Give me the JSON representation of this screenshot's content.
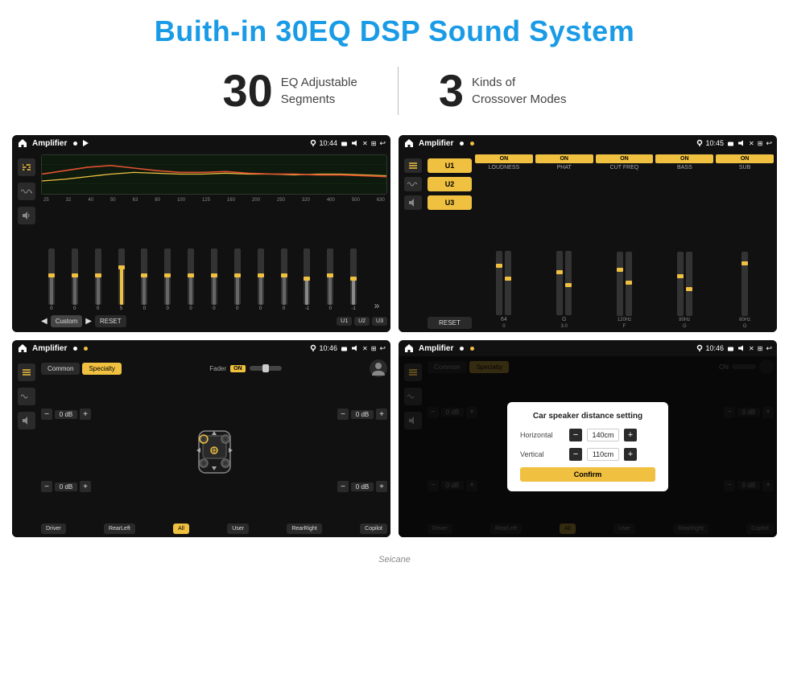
{
  "header": {
    "title": "Buith-in 30EQ DSP Sound System"
  },
  "stats": {
    "eq": {
      "number": "30",
      "desc_line1": "EQ Adjustable",
      "desc_line2": "Segments"
    },
    "crossover": {
      "number": "3",
      "desc_line1": "Kinds of",
      "desc_line2": "Crossover Modes"
    }
  },
  "screen1": {
    "title": "Amplifier",
    "time": "10:44",
    "eq_labels": [
      "25",
      "32",
      "40",
      "50",
      "63",
      "80",
      "100",
      "125",
      "160",
      "200",
      "250",
      "320",
      "400",
      "500",
      "630"
    ],
    "preset": "Custom",
    "reset_btn": "RESET",
    "u1_btn": "U1",
    "u2_btn": "U2",
    "u3_btn": "U3",
    "slider_values": [
      "0",
      "0",
      "0",
      "5",
      "0",
      "0",
      "0",
      "0",
      "0",
      "0",
      "0",
      "-1",
      "0",
      "-1"
    ]
  },
  "screen2": {
    "title": "Amplifier",
    "time": "10:45",
    "bands": [
      {
        "on": "ON",
        "name": "LOUDNESS"
      },
      {
        "on": "ON",
        "name": "PHAT"
      },
      {
        "on": "ON",
        "name": "CUT FREQ"
      },
      {
        "on": "ON",
        "name": "BASS"
      },
      {
        "on": "ON",
        "name": "SUB"
      }
    ],
    "u_btns": [
      "U1",
      "U2",
      "U3"
    ],
    "reset_btn": "RESET"
  },
  "screen3": {
    "title": "Amplifier",
    "time": "10:46",
    "tabs": [
      "Common",
      "Specialty"
    ],
    "active_tab": "Specialty",
    "fader_label": "Fader",
    "on_label": "ON",
    "db_controls": [
      {
        "label": "0 dB"
      },
      {
        "label": "0 dB"
      },
      {
        "label": "0 dB"
      },
      {
        "label": "0 dB"
      }
    ],
    "bottom_btns": [
      "Driver",
      "RearLeft",
      "All",
      "User",
      "RearRight",
      "Copilot"
    ]
  },
  "screen4": {
    "title": "Amplifier",
    "time": "10:46",
    "tabs": [
      "Common",
      "Specialty"
    ],
    "active_tab": "Specialty",
    "on_label": "ON",
    "dialog": {
      "title": "Car speaker distance setting",
      "horizontal_label": "Horizontal",
      "horizontal_value": "140cm",
      "vertical_label": "Vertical",
      "vertical_value": "110cm",
      "confirm_btn": "Confirm"
    },
    "bottom_btns": [
      "Driver",
      "RearLeft",
      "User",
      "RearRight",
      "Copilot"
    ],
    "db_controls": [
      {
        "label": "0 dB"
      },
      {
        "label": "0 dB"
      }
    ]
  },
  "watermark": "Seicane",
  "icons": {
    "home": "⌂",
    "back": "↩",
    "play": "▶",
    "prev": "◀",
    "pin": "📍",
    "cam": "📷",
    "vol": "🔊",
    "close": "✕",
    "expand": "⊞",
    "eq_icon": "≋",
    "wave": "∿",
    "speaker": "⏺",
    "chevron_up": "▲",
    "chevron_down": "▼",
    "minus": "−",
    "plus": "+"
  }
}
